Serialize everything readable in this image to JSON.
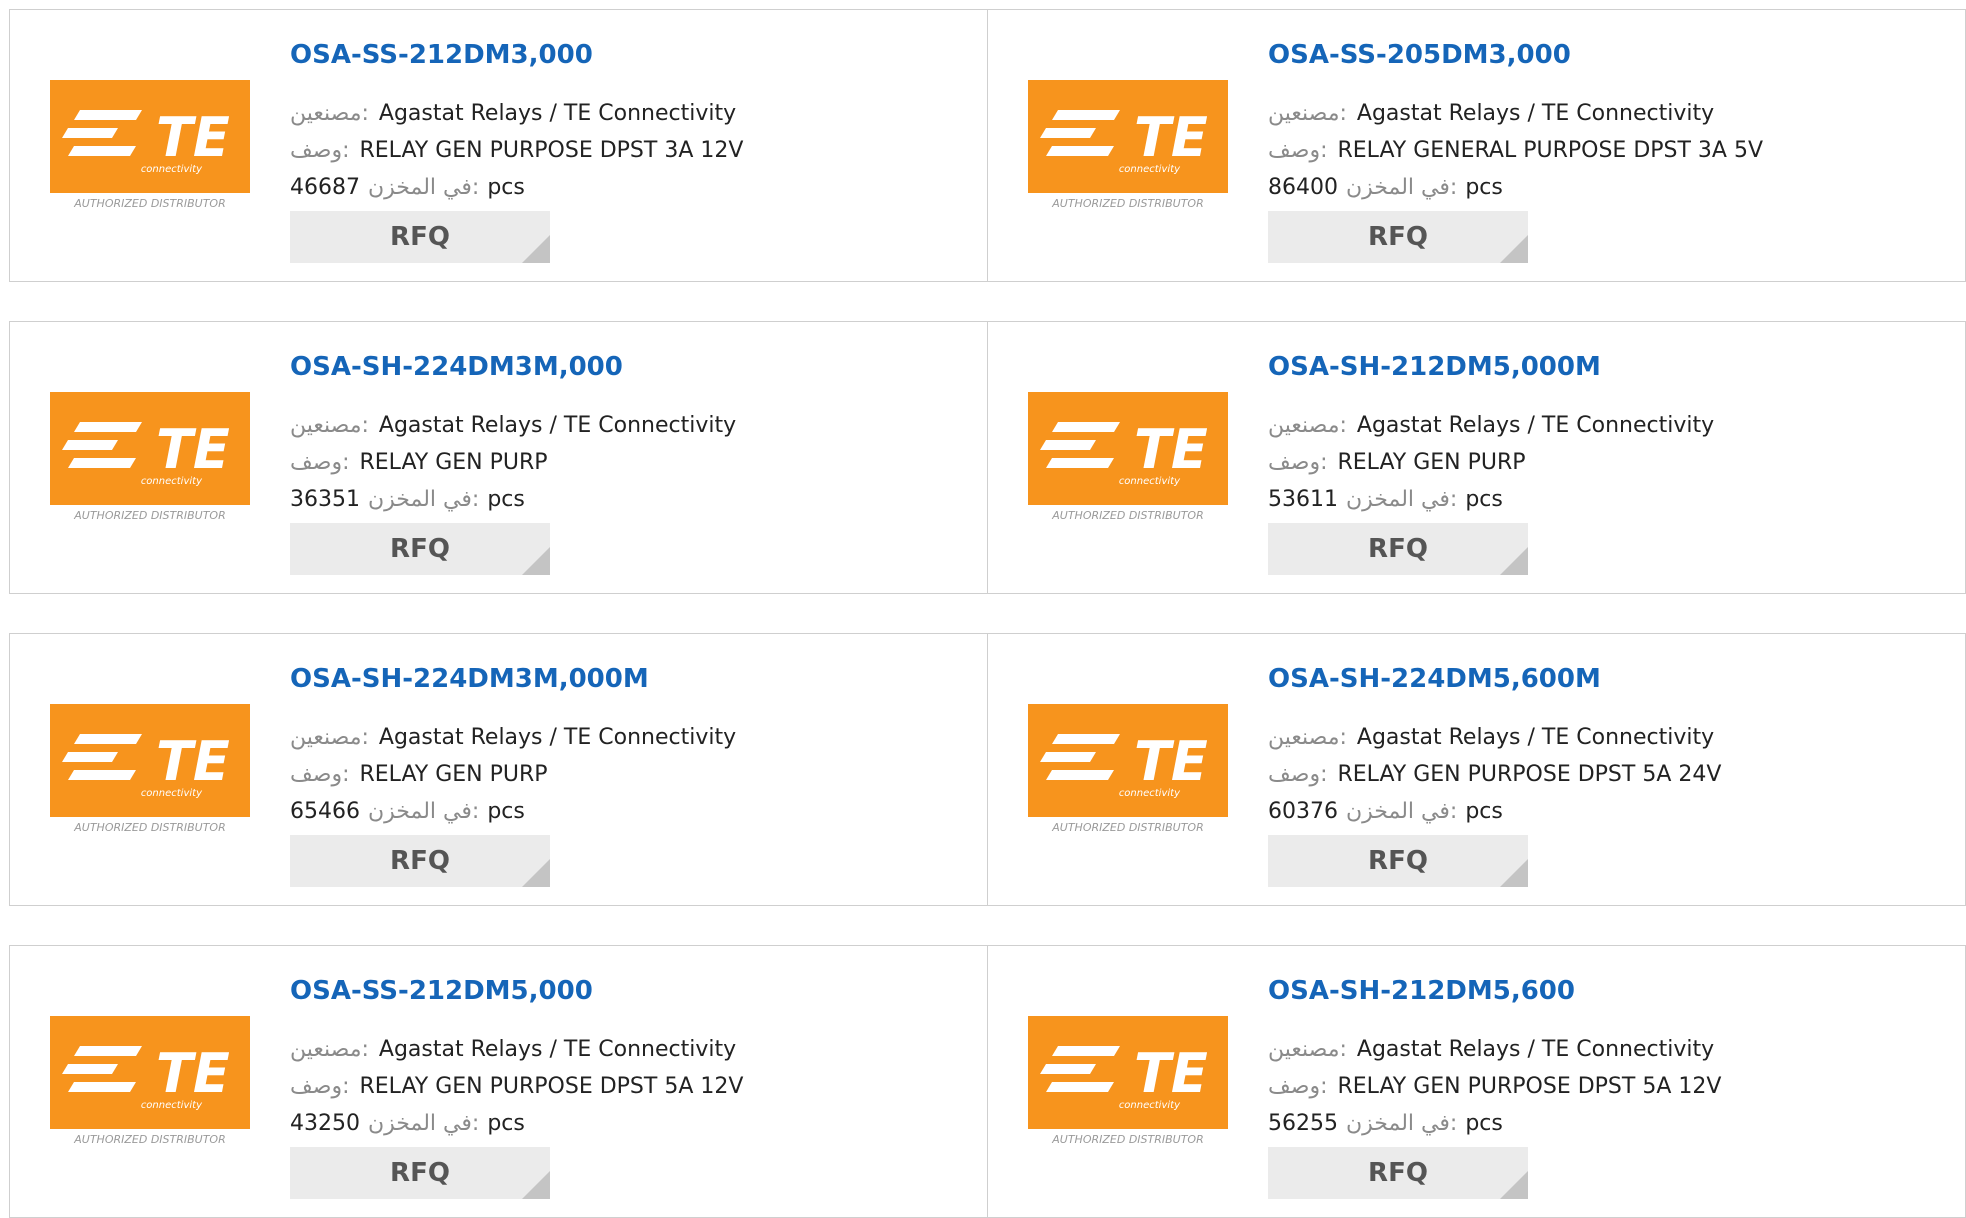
{
  "labels": {
    "manufacturer": "مصنعين:",
    "description": "وصف:",
    "stock": "في المخزن:",
    "unit": "pcs",
    "rfq": "RFQ"
  },
  "logo": {
    "brand": "TE",
    "sub": "connectivity",
    "badge": "AUTHORIZED DISTRIBUTOR",
    "color": "#f7941d"
  },
  "colors": {
    "title": "#1565b8",
    "border": "#cfcfcf",
    "button_bg": "#ebebeb"
  },
  "products": [
    {
      "part": "OSA-SS-212DM3,000",
      "manufacturer": "Agastat Relays / TE Connectivity",
      "description": "RELAY GEN PURPOSE DPST 3A 12V",
      "stock": "46687"
    },
    {
      "part": "OSA-SS-205DM3,000",
      "manufacturer": "Agastat Relays / TE Connectivity",
      "description": "RELAY GENERAL PURPOSE DPST 3A 5V",
      "stock": "86400"
    },
    {
      "part": "OSA-SH-224DM3M,000",
      "manufacturer": "Agastat Relays / TE Connectivity",
      "description": "RELAY GEN PURP",
      "stock": "36351"
    },
    {
      "part": "OSA-SH-212DM5,000M",
      "manufacturer": "Agastat Relays / TE Connectivity",
      "description": "RELAY GEN PURP",
      "stock": "53611"
    },
    {
      "part": "OSA-SH-224DM3M,000M",
      "manufacturer": "Agastat Relays / TE Connectivity",
      "description": "RELAY GEN PURP",
      "stock": "65466"
    },
    {
      "part": "OSA-SH-224DM5,600M",
      "manufacturer": "Agastat Relays / TE Connectivity",
      "description": "RELAY GEN PURPOSE DPST 5A 24V",
      "stock": "60376"
    },
    {
      "part": "OSA-SS-212DM5,000",
      "manufacturer": "Agastat Relays / TE Connectivity",
      "description": "RELAY GEN PURPOSE DPST 5A 12V",
      "stock": "43250"
    },
    {
      "part": "OSA-SH-212DM5,600",
      "manufacturer": "Agastat Relays / TE Connectivity",
      "description": "RELAY GEN PURPOSE DPST 5A 12V",
      "stock": "56255"
    }
  ]
}
